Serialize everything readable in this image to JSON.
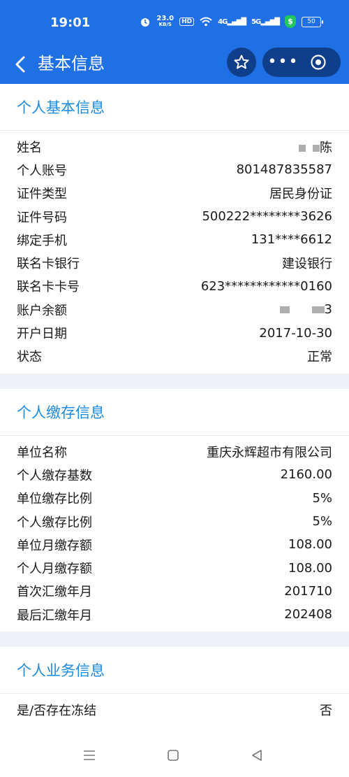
{
  "status_bar": {
    "time": "19:01",
    "net_speed": "23.0",
    "net_speed_unit": "KB/S",
    "hd_label": "HD",
    "signal1": "4G",
    "signal2": "5G",
    "shield_symbol": "$",
    "battery": "50"
  },
  "nav": {
    "title": "基本信息",
    "more_label": "•••"
  },
  "sections": [
    {
      "title": "个人基本信息",
      "rows": [
        {
          "label": "姓名",
          "value": "陈"
        },
        {
          "label": "个人账号",
          "value": "801487835587"
        },
        {
          "label": "证件类型",
          "value": "居民身份证"
        },
        {
          "label": "证件号码",
          "value": "500222********3626"
        },
        {
          "label": "绑定手机",
          "value": "131****6612"
        },
        {
          "label": "联名卡银行",
          "value": "建设银行"
        },
        {
          "label": "联名卡卡号",
          "value": "623************0160"
        },
        {
          "label": "账户余额",
          "value": "3"
        },
        {
          "label": "开户日期",
          "value": "2017-10-30"
        },
        {
          "label": "状态",
          "value": "正常"
        }
      ]
    },
    {
      "title": "个人缴存信息",
      "rows": [
        {
          "label": "单位名称",
          "value": "重庆永辉超市有限公司"
        },
        {
          "label": "个人缴存基数",
          "value": "2160.00"
        },
        {
          "label": "单位缴存比例",
          "value": "5%"
        },
        {
          "label": "个人缴存比例",
          "value": "5%"
        },
        {
          "label": "单位月缴存额",
          "value": "108.00"
        },
        {
          "label": "个人月缴存额",
          "value": "108.00"
        },
        {
          "label": "首次汇缴年月",
          "value": "201710"
        },
        {
          "label": "最后汇缴年月",
          "value": "202408"
        }
      ]
    },
    {
      "title": "个人业务信息",
      "rows": [
        {
          "label": "是/否存在冻结",
          "value": "否"
        }
      ]
    }
  ],
  "colors": {
    "header_bg": "#1f6fe5",
    "section_title": "#1d8be0",
    "capsule_bg": "#0f3f8a",
    "gap_bg": "#eef2f7"
  }
}
